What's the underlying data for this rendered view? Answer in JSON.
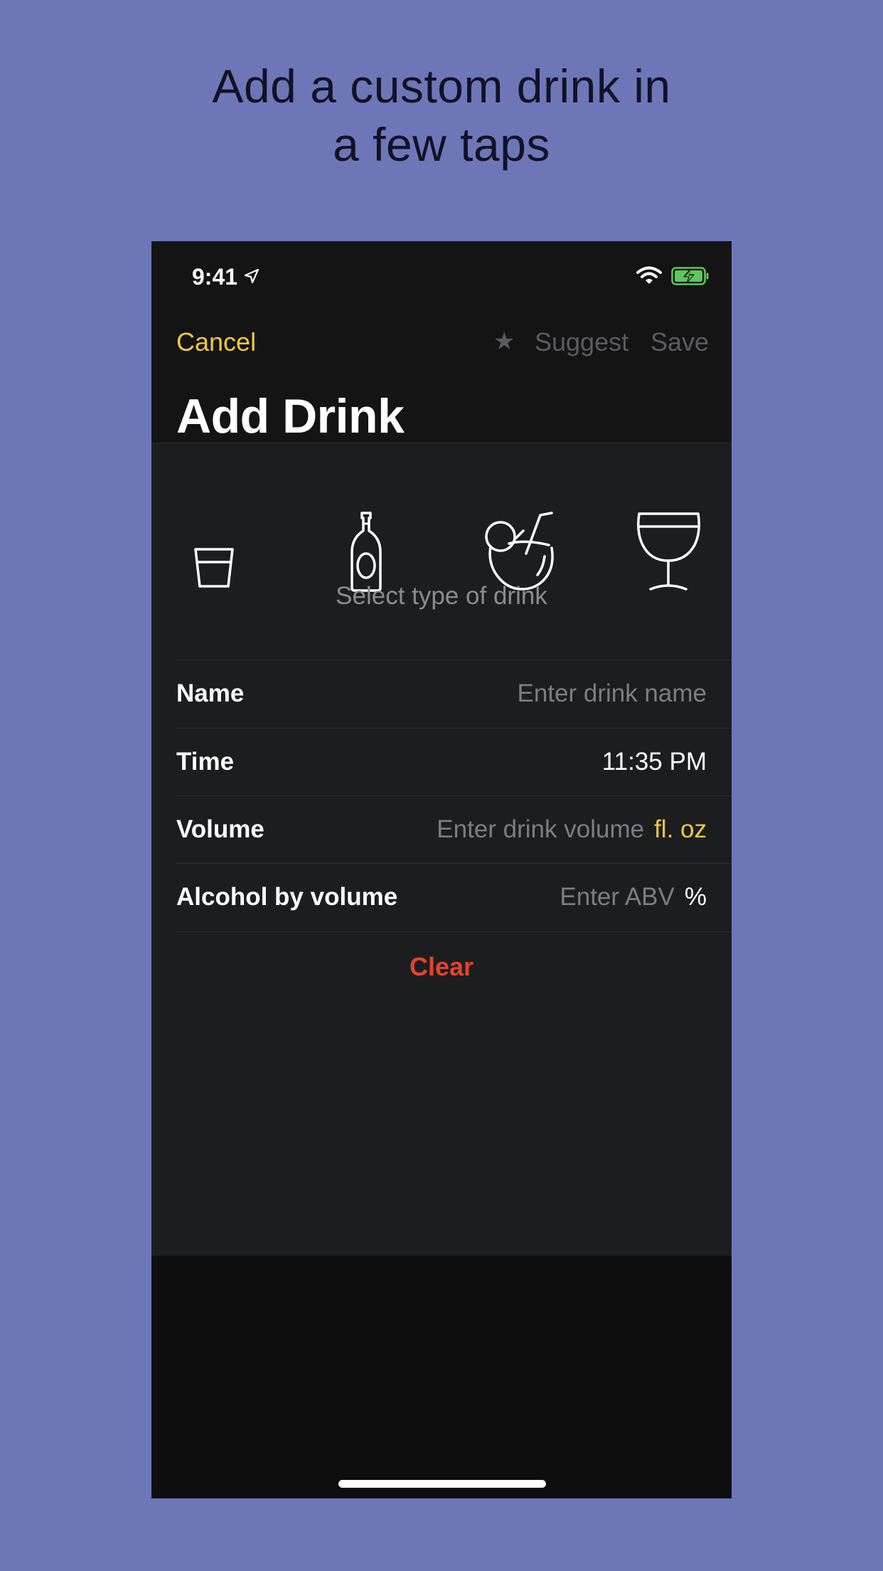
{
  "headline": {
    "line1": "Add a custom drink in",
    "line2": "a few taps"
  },
  "status_bar": {
    "time": "9:41",
    "icons": [
      "location-arrow-icon",
      "wifi-icon",
      "battery-charging-icon"
    ]
  },
  "nav": {
    "cancel_label": "Cancel",
    "star_glyph": "★",
    "suggest_label": "Suggest",
    "save_label": "Save",
    "title": "Add Drink"
  },
  "drink_types": {
    "icons": [
      "shot-glass-icon",
      "beer-bottle-icon",
      "coconut-cocktail-icon",
      "wine-glass-icon"
    ],
    "label": "Select type of drink"
  },
  "form": {
    "name": {
      "label": "Name",
      "placeholder": "Enter drink name"
    },
    "time": {
      "label": "Time",
      "value": "11:35 PM"
    },
    "volume": {
      "label": "Volume",
      "placeholder": "Enter drink volume",
      "unit": "fl. oz"
    },
    "abv": {
      "label": "Alcohol by volume",
      "placeholder": "Enter ABV",
      "unit": "%"
    },
    "clear_label": "Clear"
  },
  "colors": {
    "background": "#6d77b8",
    "accent_yellow": "#f1c93c",
    "destructive_red": "#e4432c",
    "card": "#1c1d1f"
  }
}
